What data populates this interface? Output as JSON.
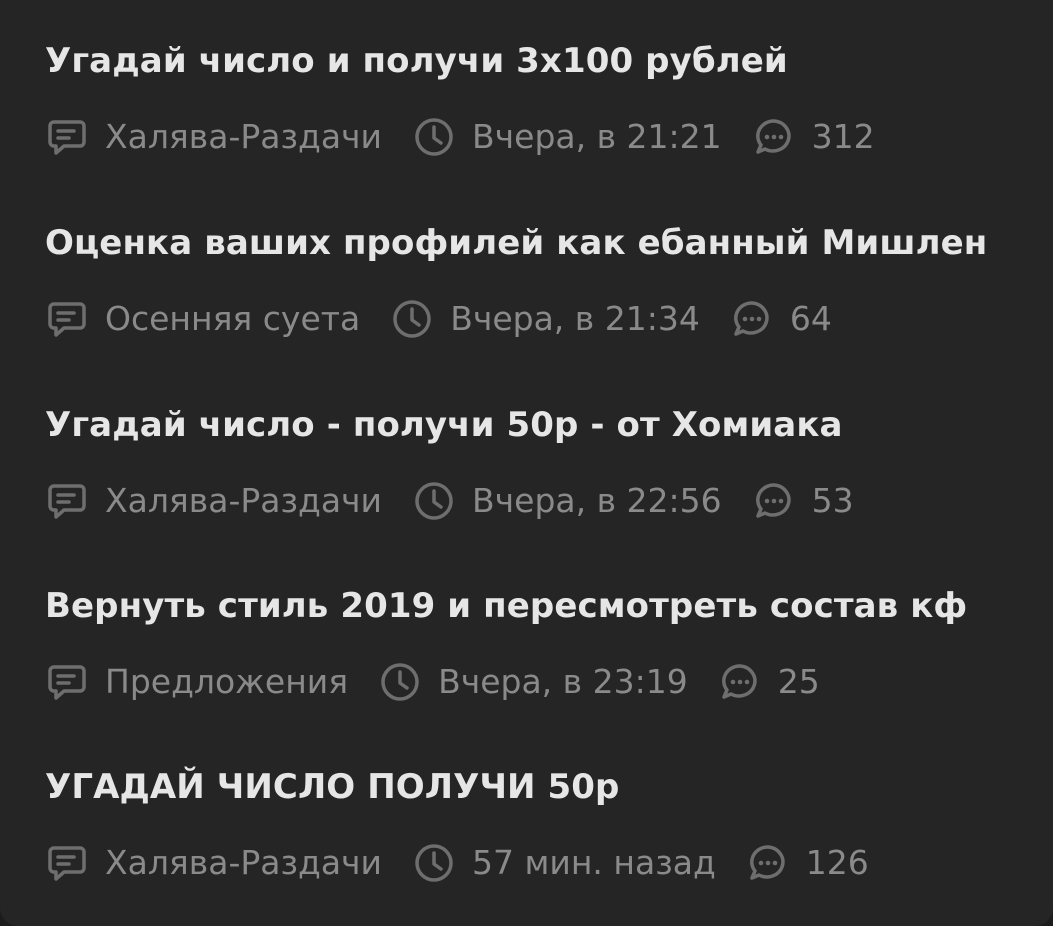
{
  "threads": [
    {
      "title": "Угадай число и получи 3х100 рублей",
      "forum": "Халява-Раздачи",
      "time": "Вчера, в 21:21",
      "replies": "312"
    },
    {
      "title": "Оценка ваших профилей как ебанный Мишлен",
      "forum": "Осенняя суета",
      "time": "Вчера, в 21:34",
      "replies": "64"
    },
    {
      "title": "Угадай число - получи 50р - от Хомиака",
      "forum": "Халява-Раздачи",
      "time": "Вчера, в 22:56",
      "replies": "53"
    },
    {
      "title": "Вернуть стиль 2019 и пересмотреть состав кф",
      "forum": "Предложения",
      "time": "Вчера, в 23:19",
      "replies": "25"
    },
    {
      "title": "УГАДАЙ ЧИСЛО ПОЛУЧИ 50р",
      "forum": "Халява-Раздачи",
      "time": "57 мин. назад",
      "replies": "126"
    }
  ],
  "colors": {
    "background": "#252525",
    "title": "#e6e6e6",
    "meta": "#8a8a8a",
    "icon": "#6e6e6e"
  },
  "icons": {
    "forum": "forum-message-icon",
    "time": "clock-icon",
    "replies": "comment-bubble-icon"
  }
}
